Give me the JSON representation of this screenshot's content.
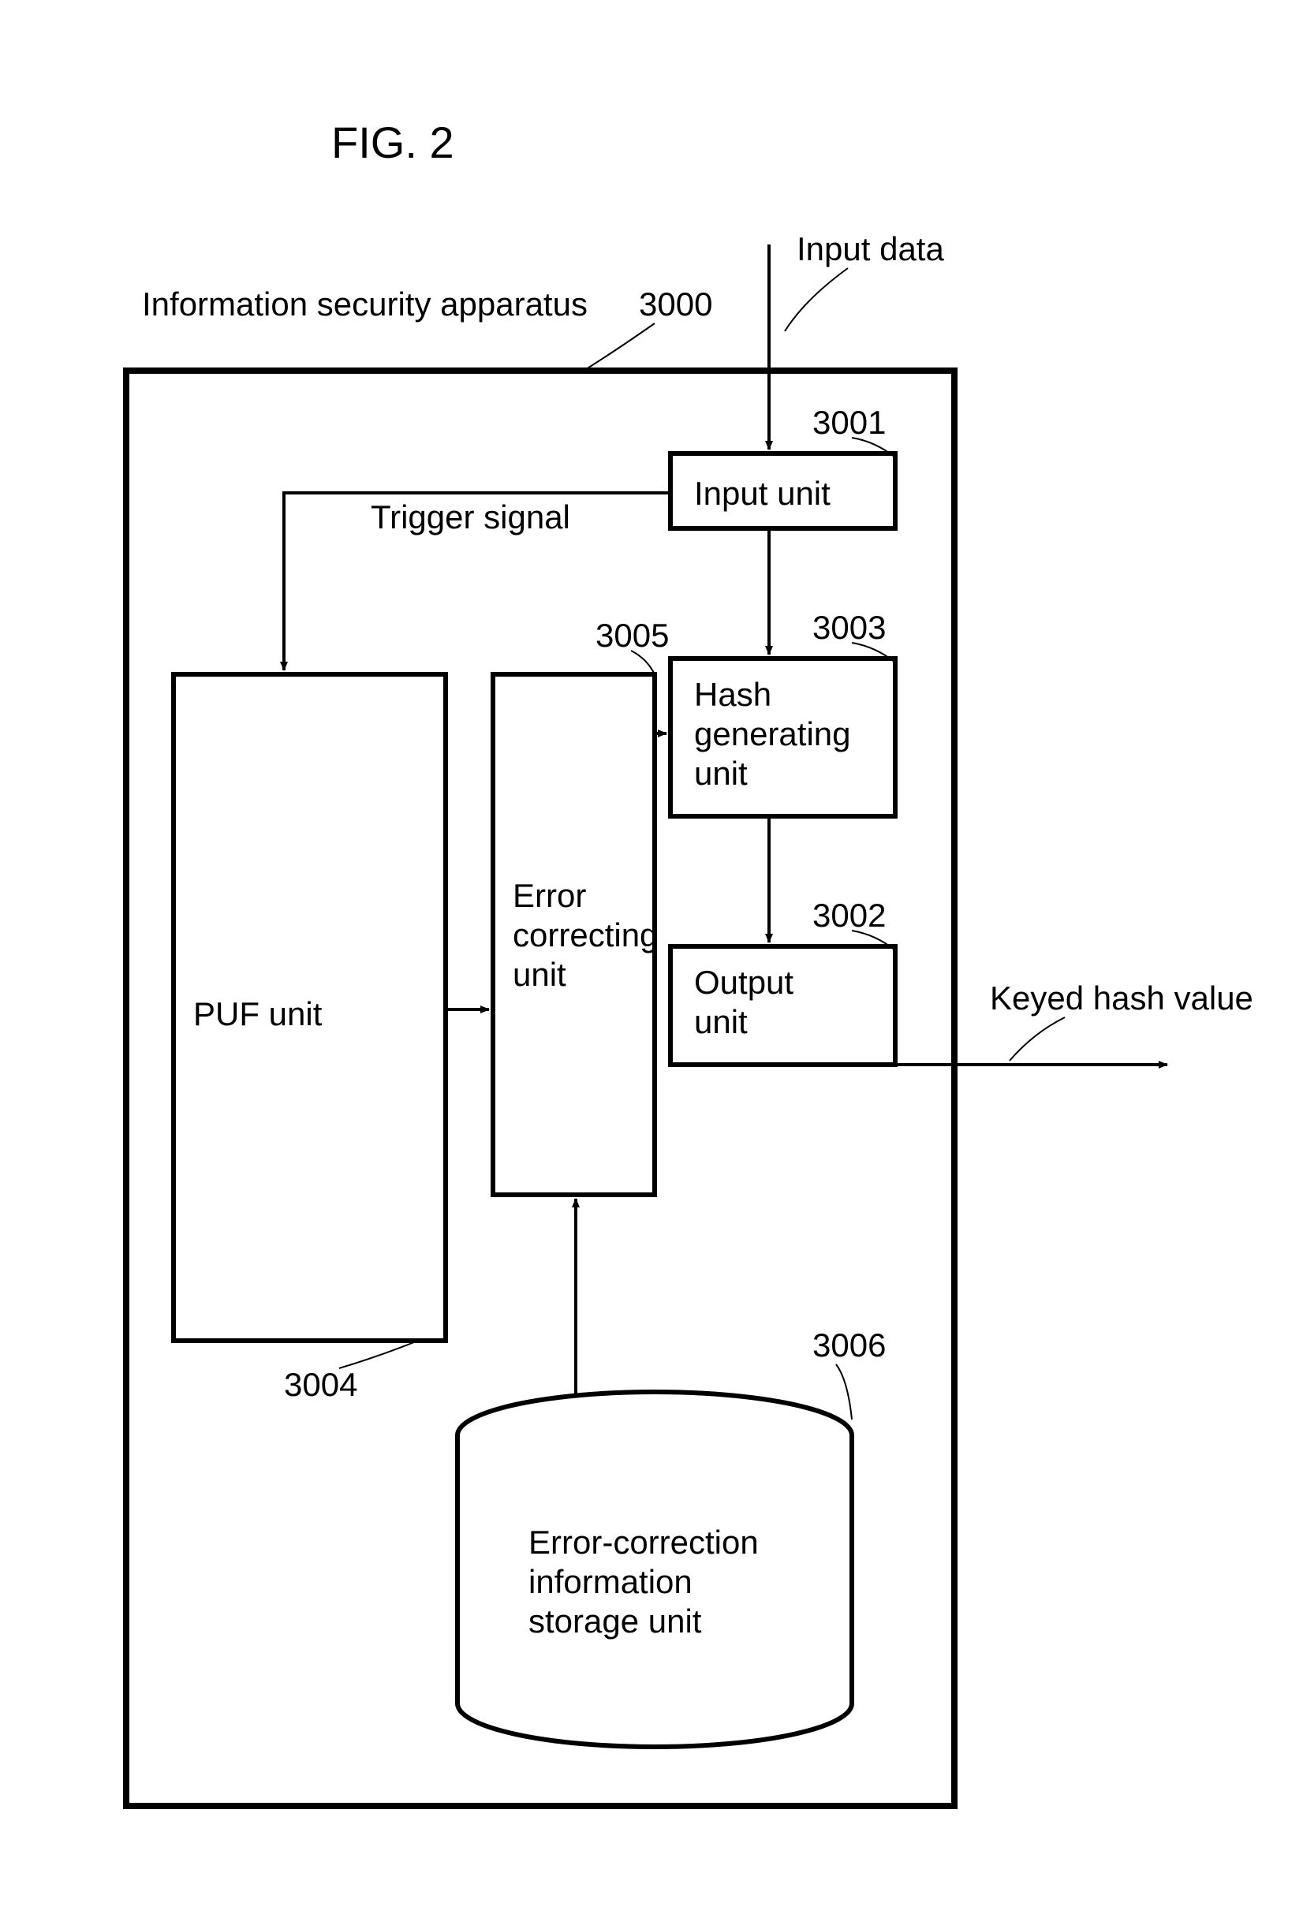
{
  "figure_label": "FIG. 2",
  "outer_label": "Information security apparatus",
  "input_label": "Input data",
  "output_label": "Keyed hash value",
  "trigger_label": "Trigger signal",
  "refs": {
    "apparatus": "3000",
    "input_unit": "3001",
    "output_unit": "3002",
    "hash_unit": "3003",
    "puf_unit": "3004",
    "error_unit": "3005",
    "storage_unit": "3006"
  },
  "blocks": {
    "input_unit": "Input unit",
    "hash_unit_l1": "Hash",
    "hash_unit_l2": "generating",
    "hash_unit_l3": "unit",
    "output_unit_l1": "Output",
    "output_unit_l2": "unit",
    "puf_unit": "PUF unit",
    "error_unit_l1": "Error",
    "error_unit_l2": "correcting",
    "error_unit_l3": "unit",
    "storage_l1": "Error-correction",
    "storage_l2": "information",
    "storage_l3": "storage unit"
  }
}
